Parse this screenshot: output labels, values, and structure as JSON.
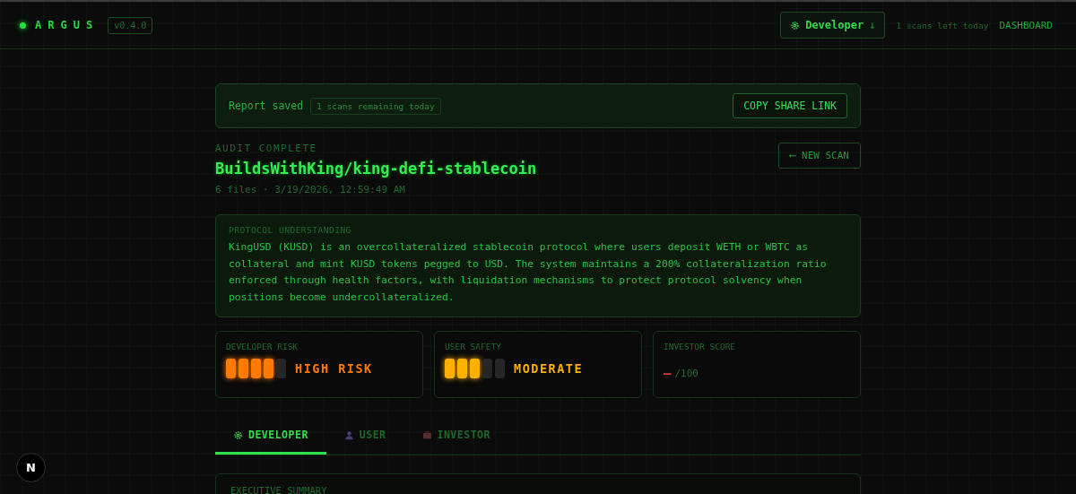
{
  "header": {
    "logo": "ARGUS",
    "version": "v0.4.0",
    "role_button": "Developer",
    "role_caret": "↓",
    "scans_left": "1 scans left today",
    "dashboard_link": "DASHBOARD"
  },
  "banner": {
    "status": "Report saved",
    "badge": "1 scans remaining today",
    "button": "COPY SHARE LINK"
  },
  "audit": {
    "label": "AUDIT COMPLETE",
    "repo": "BuildsWithKing/king-defi-stablecoin",
    "meta": "6 files · 3/19/2026, 12:59:49 AM",
    "new_scan": "⟵ NEW SCAN"
  },
  "protocol": {
    "title": "PROTOCOL UNDERSTANDING",
    "text": "KingUSD (KUSD) is an overcollateralized stablecoin protocol where users deposit WETH or WBTC as collateral and mint KUSD tokens pegged to USD. The system maintains a 200% collateralization ratio enforced through health factors, with liquidation mechanisms to protect protocol solvency when positions become undercollateralized."
  },
  "scores": [
    {
      "kind": "meter",
      "label": "DEVELOPER RISK",
      "level": 0.8,
      "color": "#ff7a00",
      "verdict": "HIGH RISK"
    },
    {
      "kind": "meter",
      "label": "USER SAFETY",
      "level": 0.6,
      "color": "#ffb000",
      "verdict": "MODERATE"
    },
    {
      "kind": "score",
      "label": "INVESTOR SCORE",
      "value": "—",
      "color": "#e03c3c",
      "suffix": "/100"
    }
  ],
  "tabs": [
    {
      "label": "DEVELOPER",
      "kind": "gear",
      "selected": true
    },
    {
      "label": "USER",
      "kind": "person",
      "selected": false
    },
    {
      "label": "INVESTOR",
      "kind": "briefcase",
      "selected": false
    }
  ],
  "summary": {
    "title": "EXECUTIVE SUMMARY"
  },
  "dev_badge": "N"
}
